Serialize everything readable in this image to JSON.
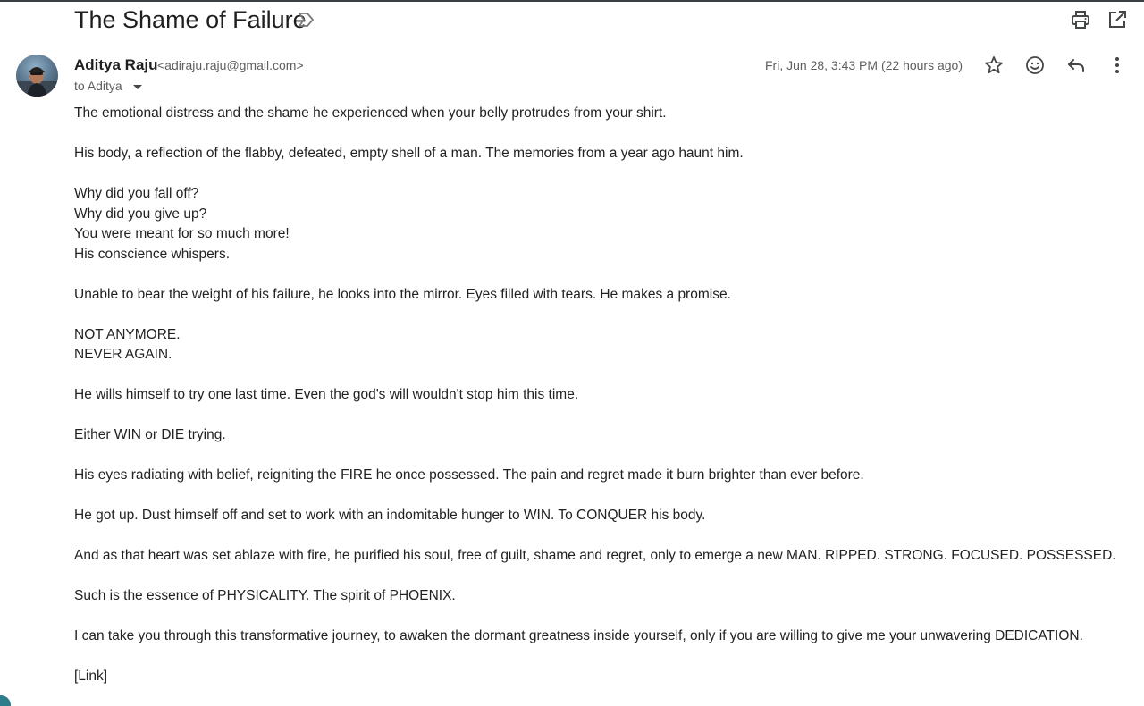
{
  "email": {
    "subject": "The Shame of Failure",
    "sender_name": "Aditya Raju",
    "sender_email": "<adiraju.raju@gmail.com>",
    "recipient_line": "to Aditya",
    "date": "Fri, Jun 28, 3:43 PM (22 hours ago)",
    "body": [
      {
        "lines": [
          "The emotional distress and the shame he experienced when your belly protrudes from your shirt."
        ]
      },
      {
        "lines": [
          "His body, a reflection of the flabby, defeated, empty shell of a man. The memories from a year ago haunt him."
        ]
      },
      {
        "lines": [
          "Why did you fall off?",
          "Why did you give up?",
          "You were meant for so much more!",
          "His conscience whispers."
        ]
      },
      {
        "lines": [
          "Unable to bear the weight of his failure, he looks into the mirror. Eyes filled with tears. He makes a promise."
        ]
      },
      {
        "lines": [
          "NOT ANYMORE.",
          "NEVER AGAIN."
        ]
      },
      {
        "lines": [
          "He wills himself to try one last time. Even the god's will wouldn't stop him this time."
        ]
      },
      {
        "lines": [
          "Either WIN or DIE trying."
        ]
      },
      {
        "lines": [
          "His eyes radiating with belief, reigniting the FIRE he once possessed. The pain and regret made it burn brighter than ever before."
        ]
      },
      {
        "lines": [
          "He got up. Dust himself off and set to work with an indomitable hunger to WIN. To CONQUER his body."
        ]
      },
      {
        "lines": [
          "And as that heart was set ablaze with fire, he purified his soul, free of guilt, shame and regret, only to emerge a new MAN. RIPPED. STRONG. FOCUSED. POSSESSED."
        ]
      },
      {
        "lines": [
          "Such is the essence of PHYSICALITY. The spirit of PHOENIX."
        ]
      },
      {
        "lines": [
          "I can take you through this transformative journey, to awaken the dormant greatness inside yourself, only if you are willing to give me your unwavering DEDICATION."
        ]
      },
      {
        "lines": [
          "[Link]"
        ]
      }
    ]
  },
  "icons": {
    "label": "label-icon",
    "print": "print-icon",
    "open_new_window": "open-in-new-window-icon",
    "star": "star-icon",
    "emoji": "emoji-reaction-icon",
    "reply": "reply-icon",
    "more": "more-vertical-icon",
    "dropdown": "chevron-down-icon"
  },
  "colors": {
    "text_primary": "#1f1f1f",
    "text_secondary": "#5e5e5e",
    "icon": "#444746",
    "background": "#ffffff"
  }
}
